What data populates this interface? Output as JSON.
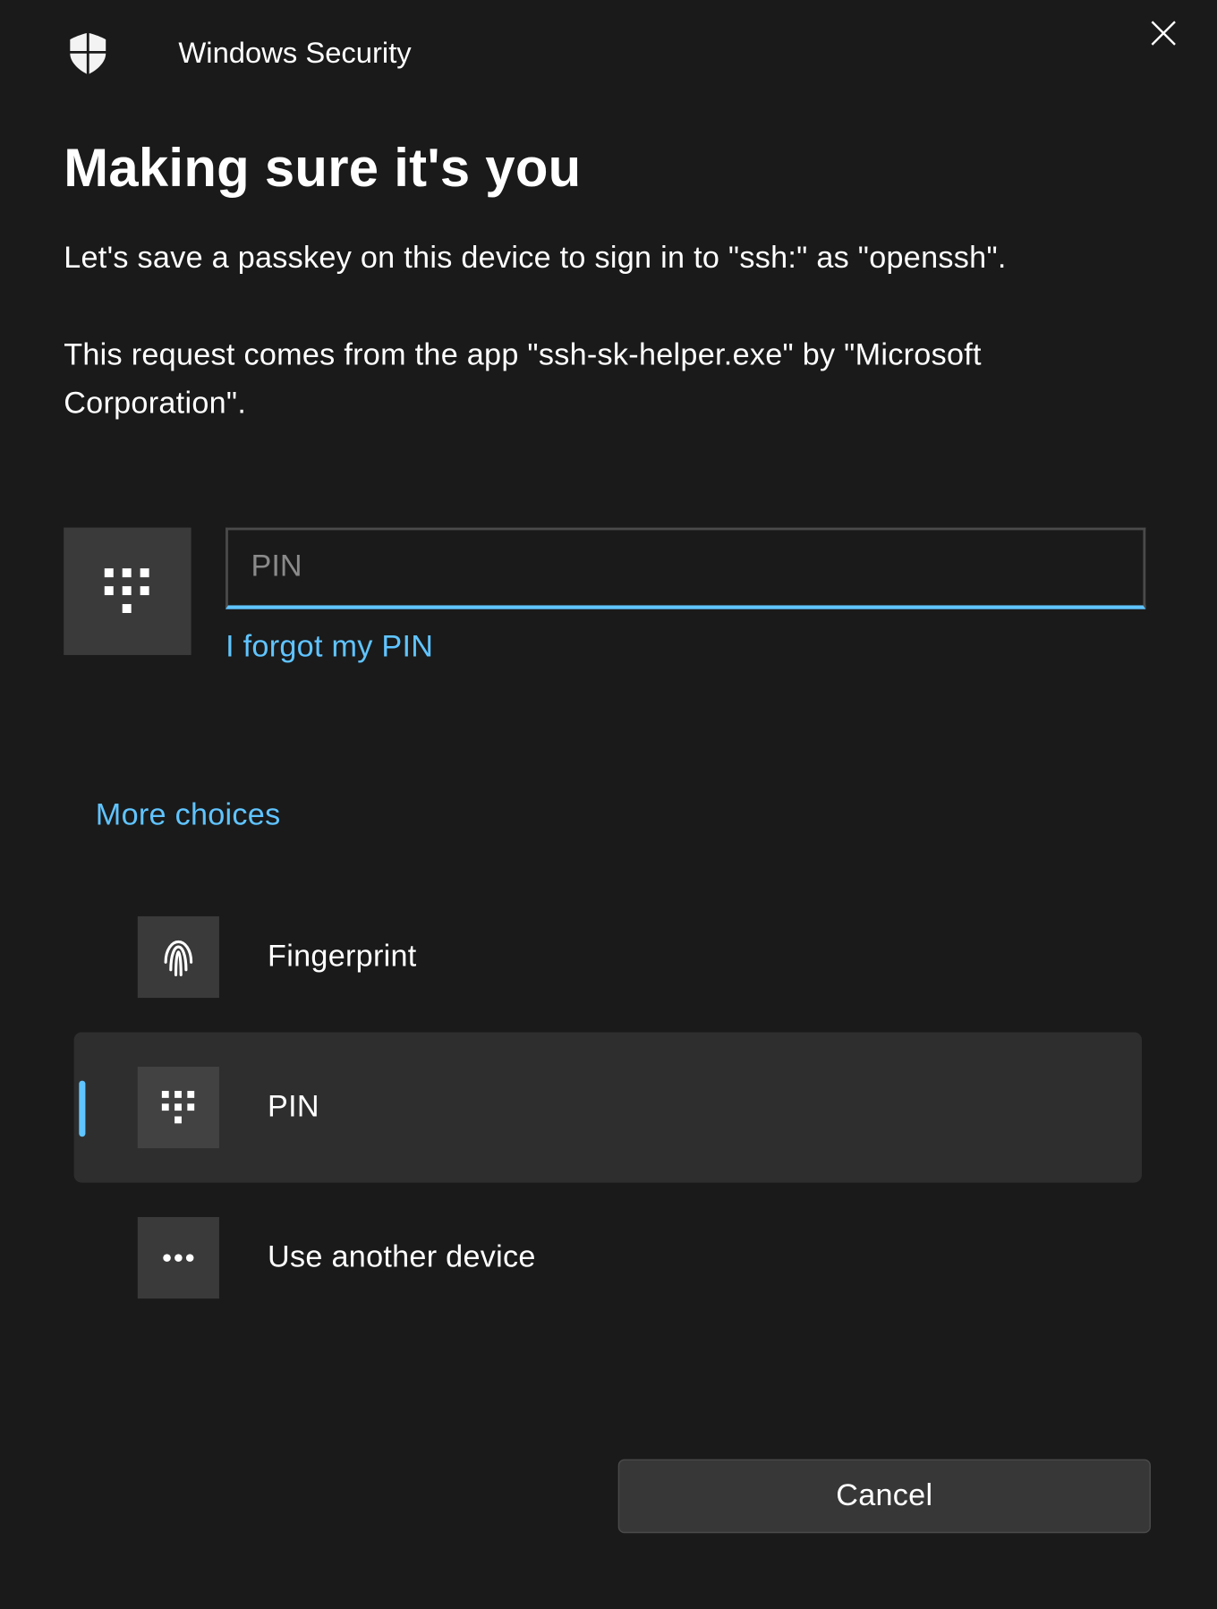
{
  "header": {
    "app_title": "Windows Security"
  },
  "main": {
    "heading": "Making sure it's you",
    "body1": "Let's save a passkey on this device to sign in to \"ssh:\" as \"openssh\".",
    "body2": "This request comes from the app \"ssh-sk-helper.exe\" by \"Microsoft Corporation\"."
  },
  "pin": {
    "placeholder": "PIN",
    "value": "",
    "forgot_label": "I forgot my PIN"
  },
  "more_choices_label": "More choices",
  "choices": [
    {
      "label": "Fingerprint",
      "icon": "fingerprint",
      "selected": false
    },
    {
      "label": "PIN",
      "icon": "pin-pad",
      "selected": true
    },
    {
      "label": "Use another device",
      "icon": "ellipsis",
      "selected": false
    }
  ],
  "footer": {
    "cancel_label": "Cancel"
  }
}
